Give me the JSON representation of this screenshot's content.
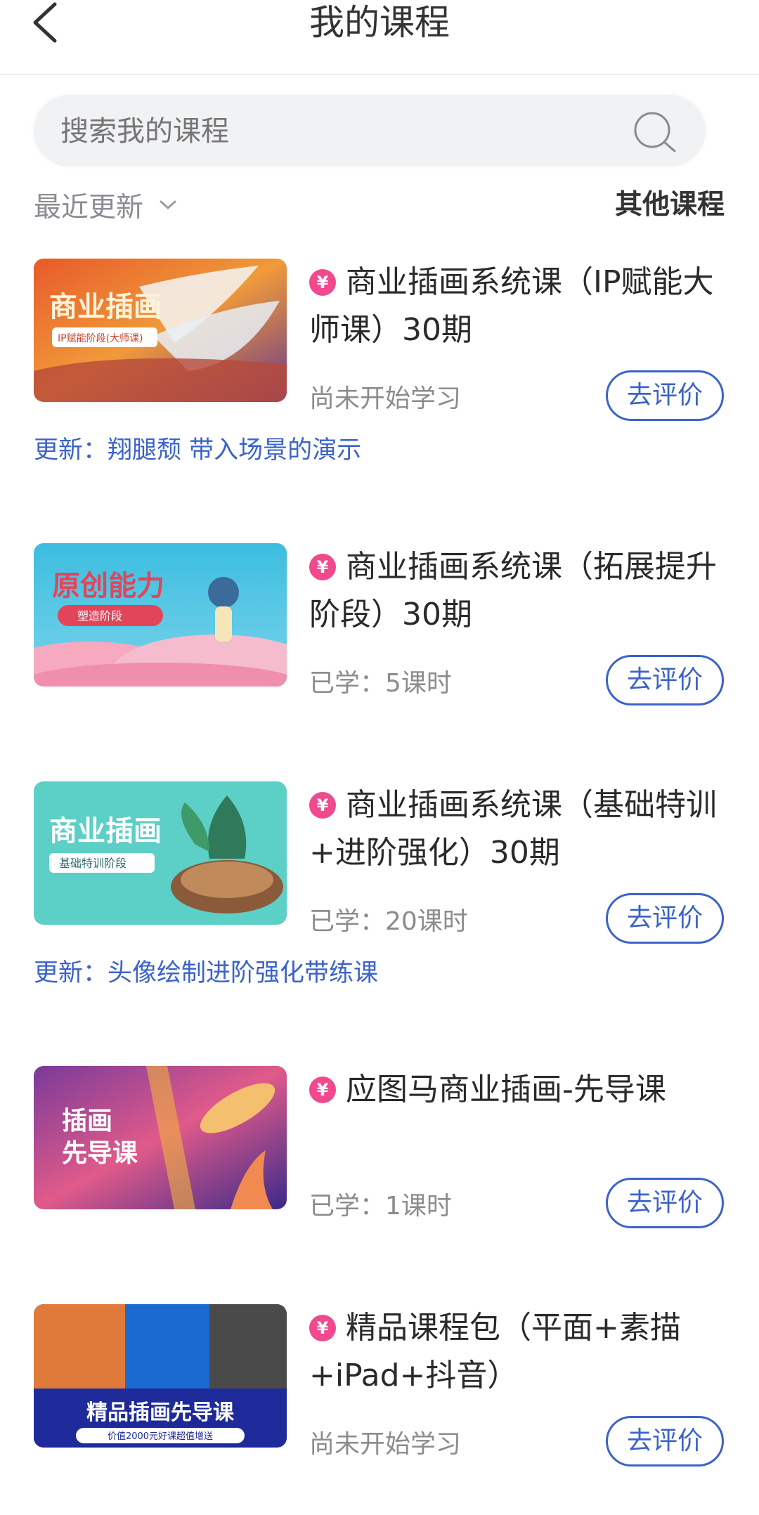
{
  "header": {
    "title": "我的课程"
  },
  "search": {
    "placeholder": "搜索我的课程"
  },
  "filter": {
    "sort_label": "最近更新",
    "other_label": "其他课程"
  },
  "courses": [
    {
      "title": "商业插画系统课（IP赋能大师课）30期",
      "progress": "尚未开始学习",
      "rate_label": "去评价",
      "update": "更新：翔腿颓 带入场景的演示",
      "thumb_title": "商业插画",
      "thumb_sub": "IP赋能阶段(大师课)"
    },
    {
      "title": "商业插画系统课（拓展提升阶段）30期",
      "progress": "已学：5课时",
      "rate_label": "去评价",
      "update": "",
      "thumb_title": "原创能力",
      "thumb_sub": "塑造阶段"
    },
    {
      "title": "商业插画系统课（基础特训+进阶强化）30期",
      "progress": "已学：20课时",
      "rate_label": "去评价",
      "update": "更新：头像绘制进阶强化带练课",
      "thumb_title": "商业插画",
      "thumb_sub": "基础特训阶段"
    },
    {
      "title": "应图马商业插画-先导课",
      "progress": "已学：1课时",
      "rate_label": "去评价",
      "update": "",
      "thumb_title": "插画",
      "thumb_sub": "先导课"
    },
    {
      "title": "精品课程包（平面+素描+iPad+抖音）",
      "progress": "尚未开始学习",
      "rate_label": "去评价",
      "update": "",
      "thumb_title": "精品插画先导课",
      "thumb_sub": "价值2000元好课超值增送"
    }
  ],
  "colors": {
    "accent": "#3b63c9",
    "badge": "#f0498d",
    "muted": "#8c8c8c"
  },
  "icons": {
    "back": "chevron-left-icon",
    "search": "search-icon",
    "badge": "yen-icon"
  }
}
